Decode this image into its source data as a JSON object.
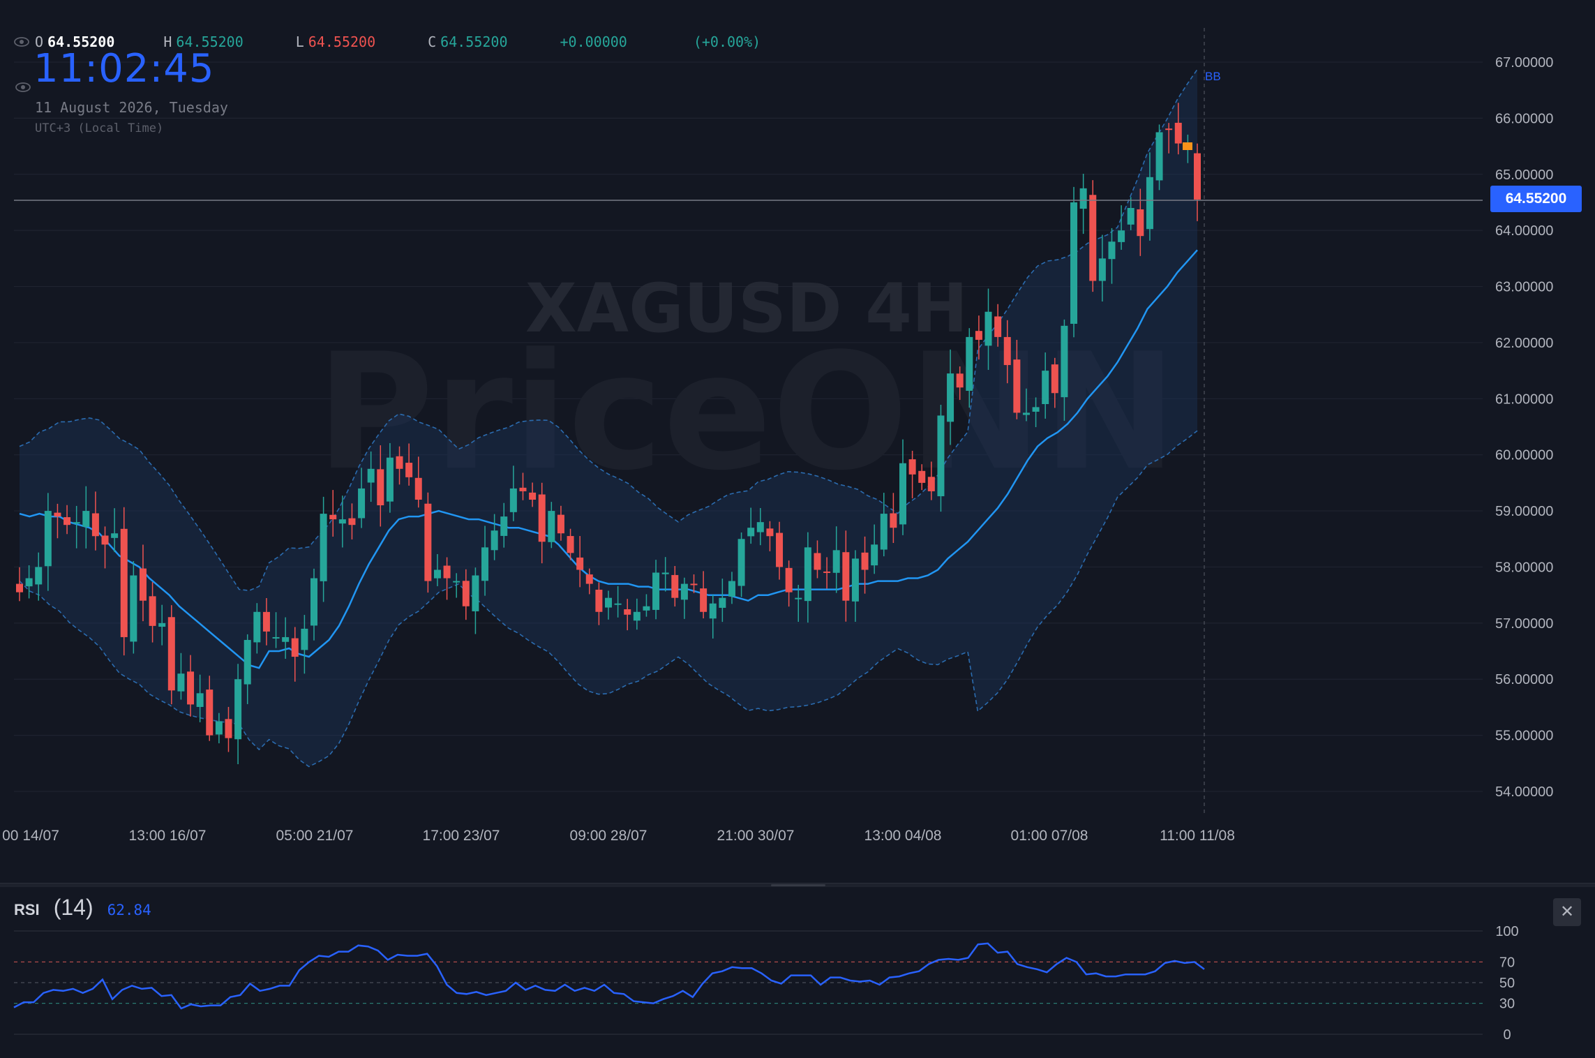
{
  "symbol_watermark": "XAGUSD 4H",
  "brand_watermark": "PriceONN",
  "ohlc": {
    "open_label": "O",
    "open": "64.55200",
    "high_label": "H",
    "high": "64.55200",
    "low_label": "L",
    "low": "64.55200",
    "close_label": "C",
    "close": "64.55200",
    "change": "+0.00000",
    "change_pct": "(+0.00%)"
  },
  "clock": "11:02:45",
  "date": "11 August 2026, Tuesday",
  "timezone": "UTC+3 (Local Time)",
  "indicator_label": "BB",
  "current_price": "64.55200",
  "colors": {
    "up": "#26a69a",
    "down": "#ef5350",
    "accent": "#2962ff",
    "basis": "#2196f3",
    "band": "#1e4e8c"
  },
  "icons": [
    "eye-icon",
    "close-icon"
  ],
  "chart_data": {
    "type": "candlestick",
    "y_axis_labels": [
      "67.00000",
      "66.00000",
      "65.00000",
      "64.00000",
      "63.00000",
      "62.00000",
      "61.00000",
      "60.00000",
      "59.00000",
      "58.00000",
      "57.00000",
      "56.00000",
      "55.00000",
      "54.00000"
    ],
    "ylim": [
      54,
      67
    ],
    "x_axis_labels": [
      "00 14/07",
      "13:00 16/07",
      "05:00 21/07",
      "17:00 23/07",
      "09:00 28/07",
      "21:00 30/07",
      "13:00 04/08",
      "01:00 07/08",
      "11:00 11/08"
    ],
    "close": [
      57.55,
      57.8,
      58.0,
      59.0,
      58.9,
      58.75,
      58.8,
      59.0,
      58.55,
      58.4,
      58.6,
      56.75,
      57.85,
      57.4,
      56.95,
      57.0,
      55.8,
      56.1,
      55.55,
      55.75,
      55.0,
      55.25,
      54.95,
      56.0,
      56.7,
      57.2,
      56.85,
      56.75,
      56.75,
      56.4,
      56.9,
      57.8,
      58.95,
      58.85,
      58.85,
      58.75,
      59.4,
      59.75,
      59.1,
      59.95,
      59.75,
      59.6,
      59.2,
      57.75,
      57.95,
      57.8,
      57.75,
      57.3,
      57.85,
      58.35,
      58.65,
      58.9,
      59.4,
      59.35,
      59.2,
      58.45,
      59.0,
      58.6,
      58.25,
      57.95,
      57.7,
      57.2,
      57.45,
      57.35,
      57.15,
      57.2,
      57.3,
      57.9,
      57.9,
      57.45,
      57.7,
      57.7,
      57.2,
      57.35,
      57.45,
      57.75,
      58.5,
      58.7,
      58.8,
      58.55,
      58.0,
      57.55,
      57.45,
      58.35,
      57.95,
      57.9,
      58.3,
      57.4,
      58.15,
      57.95,
      58.4,
      58.95,
      58.7,
      59.85,
      59.65,
      59.5,
      59.35,
      60.7,
      61.45,
      61.2,
      62.1,
      62.05,
      62.55,
      62.1,
      61.6,
      60.75,
      60.75,
      60.85,
      61.5,
      61.1,
      62.3,
      64.5,
      64.75,
      63.1,
      63.5,
      63.8,
      64.0,
      64.4,
      63.9,
      64.95,
      65.75,
      65.8,
      65.55,
      65.5,
      64.55
    ],
    "basis": [
      58.95,
      58.9,
      58.95,
      58.9,
      58.9,
      58.8,
      58.75,
      58.7,
      58.6,
      58.4,
      58.2,
      58.1,
      58.0,
      57.8,
      57.65,
      57.5,
      57.3,
      57.15,
      57.0,
      56.85,
      56.7,
      56.55,
      56.4,
      56.25,
      56.2,
      56.5,
      56.5,
      56.55,
      56.45,
      56.4,
      56.55,
      56.7,
      56.95,
      57.3,
      57.7,
      58.05,
      58.35,
      58.65,
      58.85,
      58.9,
      58.9,
      58.95,
      59.0,
      58.95,
      58.9,
      58.85,
      58.85,
      58.8,
      58.75,
      58.7,
      58.7,
      58.65,
      58.6,
      58.55,
      58.4,
      58.2,
      58.0,
      57.85,
      57.75,
      57.7,
      57.7,
      57.7,
      57.65,
      57.65,
      57.6,
      57.6,
      57.6,
      57.6,
      57.55,
      57.5,
      57.5,
      57.5,
      57.45,
      57.4,
      57.5,
      57.5,
      57.55,
      57.6,
      57.6,
      57.6,
      57.6,
      57.6,
      57.6,
      57.65,
      57.7,
      57.7,
      57.75,
      57.75,
      57.75,
      57.8,
      57.8,
      57.85,
      57.95,
      58.15,
      58.3,
      58.45,
      58.65,
      58.85,
      59.05,
      59.3,
      59.6,
      59.9,
      60.15,
      60.3,
      60.4,
      60.55,
      60.75,
      61.0,
      61.2,
      61.4,
      61.65,
      61.95,
      62.25,
      62.6,
      62.8,
      63.0,
      63.25,
      63.45,
      63.65
    ]
  },
  "rsi": {
    "label": "RSI",
    "length": "(14)",
    "value": "62.84",
    "levels": [
      "100",
      "70",
      "50",
      "30",
      "0"
    ],
    "values": [
      26,
      31,
      31,
      40,
      43,
      42,
      44,
      40,
      44,
      53,
      34,
      43,
      47,
      44,
      45,
      37,
      38,
      25,
      29,
      27,
      28,
      28,
      36,
      38,
      49,
      42,
      44,
      47,
      47,
      62,
      70,
      76,
      75,
      80,
      80,
      86,
      85,
      81,
      72,
      77,
      76,
      76,
      78,
      66,
      48,
      40,
      39,
      41,
      38,
      40,
      42,
      50,
      43,
      47,
      43,
      42,
      48,
      42,
      45,
      42,
      48,
      40,
      39,
      32,
      31,
      30,
      34,
      37,
      42,
      36,
      49,
      59,
      61,
      65,
      64,
      64,
      59,
      52,
      49,
      57,
      57,
      57,
      48,
      55,
      55,
      52,
      51,
      52,
      48,
      55,
      56,
      59,
      61,
      68,
      72,
      73,
      72,
      74,
      87,
      88,
      79,
      80,
      68,
      65,
      63,
      60,
      68,
      74,
      70,
      58,
      59,
      56,
      56,
      58,
      58,
      58,
      61,
      69,
      71,
      69,
      70,
      63
    ]
  }
}
